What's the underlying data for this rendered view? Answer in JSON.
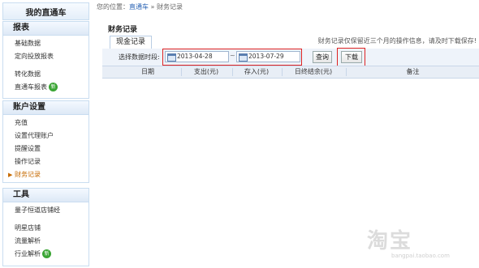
{
  "sidebar": {
    "title": "我的直通车",
    "sections": [
      {
        "header": "报表",
        "items": [
          "基础数据",
          "定向投放报表",
          "",
          "转化数据",
          "直通车报表"
        ]
      },
      {
        "header": "账户设置",
        "items": [
          "充值",
          "设置代理账户",
          "提醒设置",
          "操作记录",
          "财务记录"
        ]
      },
      {
        "header": "工具",
        "items": [
          "量子恒道店铺经",
          "",
          "明星店铺",
          "流量解析",
          "行业解析"
        ]
      }
    ],
    "badge": "新",
    "active_item": "财务记录"
  },
  "breadcrumb": {
    "prefix": "您的位置：",
    "link": "直通车",
    "separator": "»",
    "current": "财务记录"
  },
  "main": {
    "title": "财务记录",
    "tab": "现金记录",
    "notice": "财务记录仅保留近三个月的操作信息，请及时下载保存!",
    "filter": {
      "label": "选择数据时段:",
      "start_date": "2013-04-28",
      "range_separator": "~",
      "end_date": "2013-07-29",
      "query_button": "查询",
      "download_button": "下载"
    },
    "table_headers": [
      "日期",
      "支出(元)",
      "存入(元)",
      "日终结余(元)",
      "备注"
    ]
  },
  "watermark": {
    "main": "淘宝",
    "sub": "bangpai.taobao.com"
  }
}
